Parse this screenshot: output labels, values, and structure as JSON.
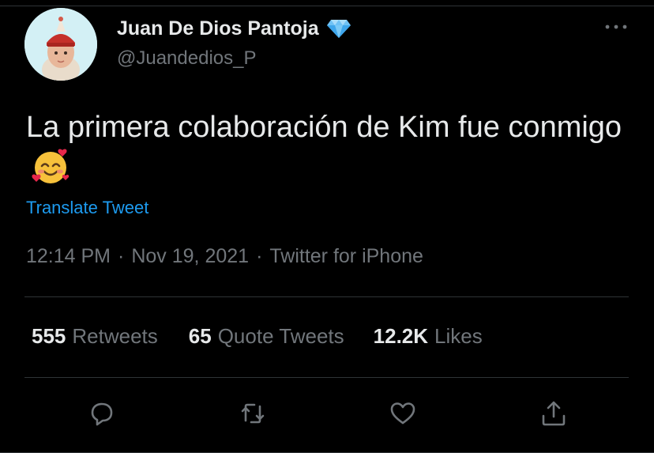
{
  "author": {
    "name": "Juan De Dios Pantoja",
    "handle": "@Juandedios_P",
    "badge_icon": "diamond-icon",
    "avatar_icon": "avatar"
  },
  "tweet": {
    "text": "La primera colaboración de Kim fue conmigo",
    "emoji_icon": "smiling-face-with-hearts-icon",
    "translate_label": "Translate Tweet",
    "time": "12:14 PM",
    "date": "Nov 19, 2021",
    "source": "Twitter for iPhone",
    "separator": "·"
  },
  "stats": {
    "retweets_count": "555",
    "retweets_label": "Retweets",
    "quotes_count": "65",
    "quotes_label": "Quote Tweets",
    "likes_count": "12.2K",
    "likes_label": "Likes"
  },
  "actions": [
    "reply-icon",
    "retweet-icon",
    "like-icon",
    "share-icon"
  ],
  "colors": {
    "background": "#000000",
    "text": "#e7e9ea",
    "secondary": "#71767b",
    "link": "#1d9bf0",
    "divider": "#2f3336"
  }
}
